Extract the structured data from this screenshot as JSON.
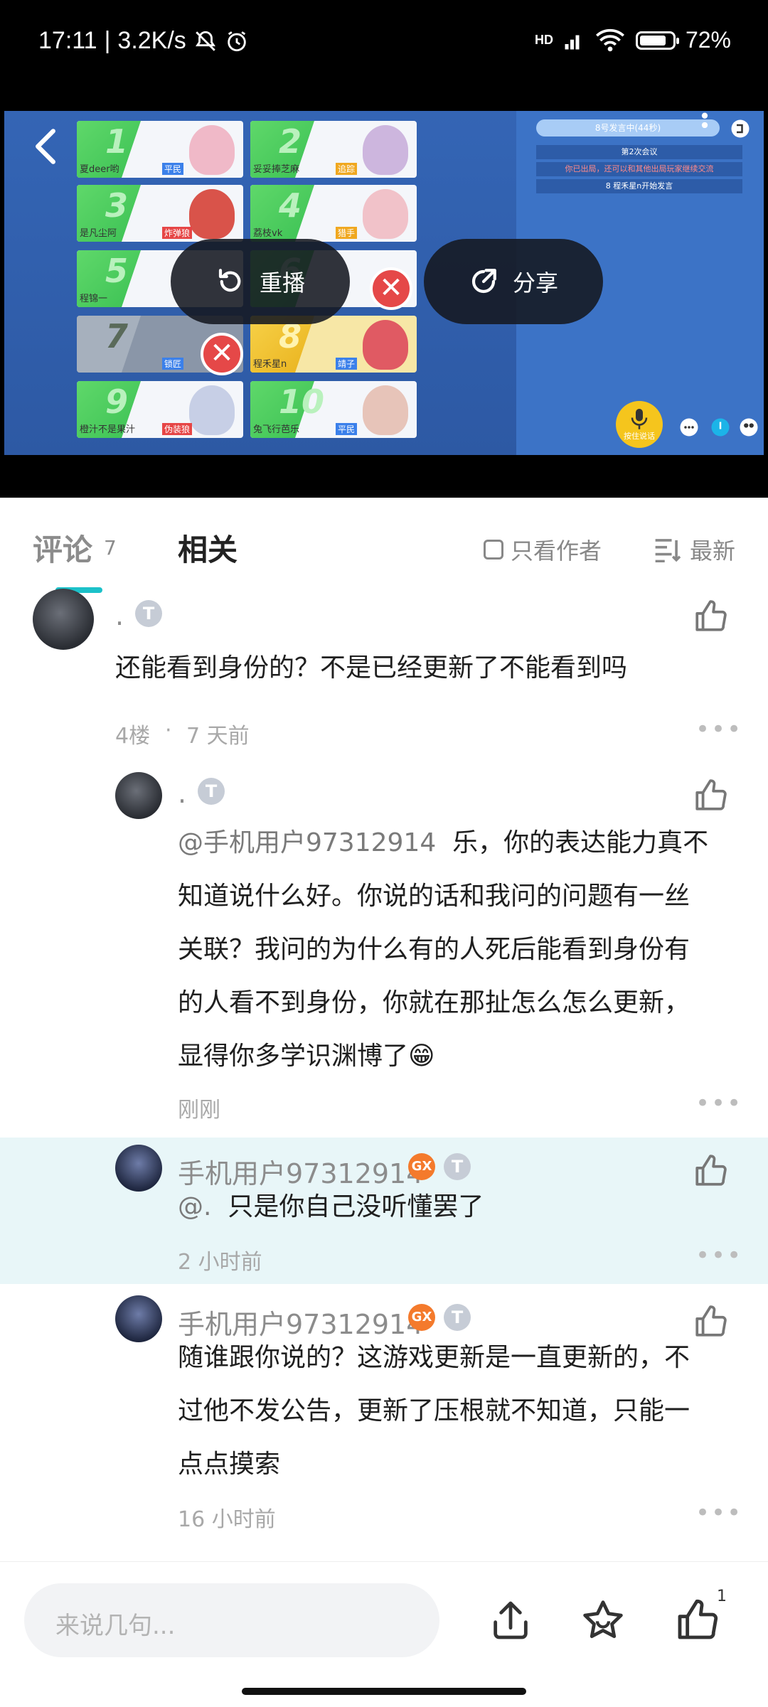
{
  "status_bar": {
    "time": "17:11",
    "speed": "3.2K/s",
    "network": "HD",
    "battery": "72%"
  },
  "video": {
    "replay_label": "重播",
    "share_label": "分享",
    "players": [
      {
        "num": "1",
        "name": "夏deer哟",
        "role": "平民"
      },
      {
        "num": "2",
        "name": "妥妥捧芝麻",
        "role": "追踪"
      },
      {
        "num": "3",
        "name": "是凡尘阿",
        "role": "炸弹狼"
      },
      {
        "num": "4",
        "name": "荔枝vk",
        "role": "猎手"
      },
      {
        "num": "5",
        "name": "程锦一",
        "role": ""
      },
      {
        "num": "6",
        "name": "",
        "role": ""
      },
      {
        "num": "7",
        "name": "",
        "role": "锁匠"
      },
      {
        "num": "8",
        "name": "程禾星n",
        "role": "靖子"
      },
      {
        "num": "9",
        "name": "橙汁不是果汁",
        "role": "伪装狼"
      },
      {
        "num": "10",
        "name": "兔飞行芭乐",
        "role": "平民"
      }
    ],
    "panel": {
      "banner": "8号发言中(44秒)",
      "meeting": "第2次会议",
      "notice": "你已出局，还可以和其他出局玩家继续交流",
      "speaking": "8 程禾星n开始发言",
      "mic_label": "按住说话"
    }
  },
  "tabs": {
    "comment_label": "评论",
    "comment_count": "7",
    "related_label": "相关",
    "author_only_label": "只看作者",
    "sort_label": "最新"
  },
  "comments": [
    {
      "username": ".",
      "text": "还能看到身份的？不是已经更新了不能看到吗",
      "floor": "4楼",
      "time": "7 天前"
    }
  ],
  "replies": [
    {
      "username": ".",
      "mention": "@手机用户97312914",
      "lines": [
        "乐，你的表达能力真不",
        "知道说什么好。你说的话和我问的问题有一丝",
        "关联？我问的为什么有的人死后能看到身份有",
        "的人看不到身份，你就在那扯怎么怎么更新，",
        "显得你多学识渊博了"
      ],
      "emoji": "😁",
      "time": "刚刚"
    },
    {
      "username": "手机用户97312914",
      "mention": "@.",
      "text": "只是你自己没听懂罢了",
      "time": "2 小时前"
    },
    {
      "username": "手机用户97312914",
      "lines": [
        "随谁跟你说的？这游戏更新是一直更新的，不",
        "过他不发公告，更新了压根就不知道，只能一",
        "点点摸索"
      ],
      "time": "16 小时前"
    }
  ],
  "bottom_bar": {
    "input_placeholder": "来说几句...",
    "like_count": "1"
  },
  "badges": {
    "t_badge": "T",
    "game_badge": "GX"
  }
}
